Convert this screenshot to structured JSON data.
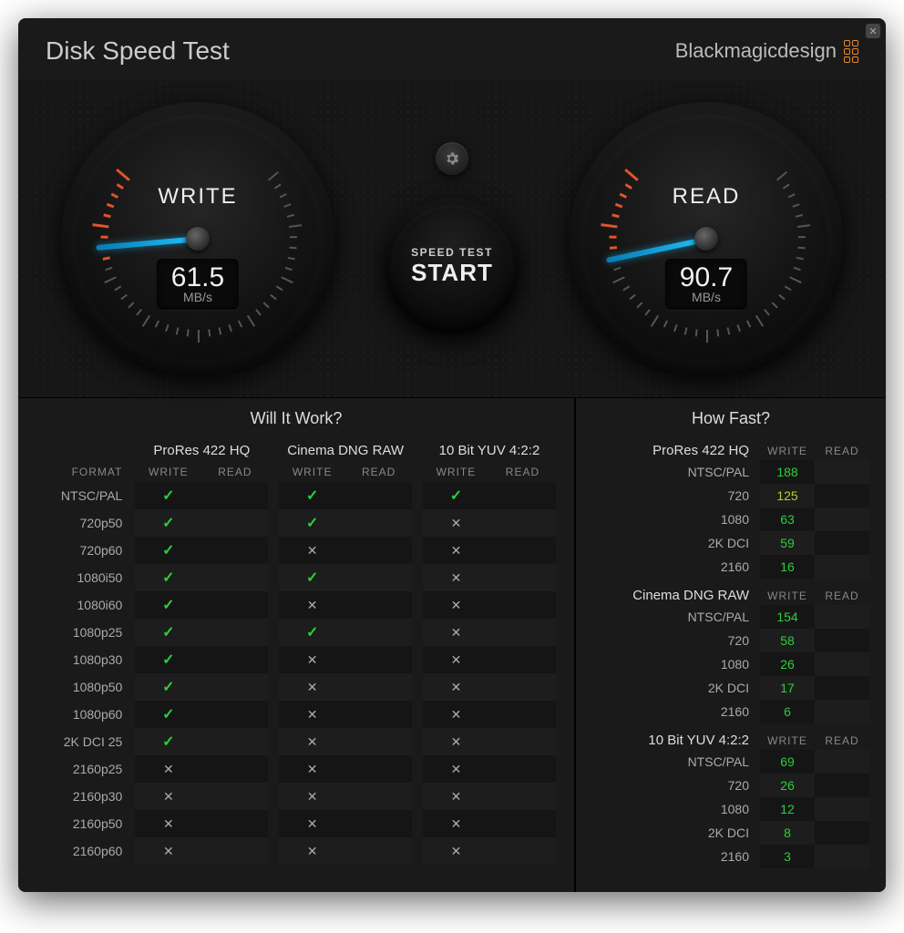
{
  "app": {
    "title": "Disk Speed Test",
    "brand": "Blackmagicdesign"
  },
  "gauges": {
    "write": {
      "label": "WRITE",
      "value": "61.5",
      "unit": "MB/s",
      "needle_angle": 85
    },
    "read": {
      "label": "READ",
      "value": "90.7",
      "unit": "MB/s",
      "needle_angle": 78
    }
  },
  "center": {
    "start_sub": "SPEED TEST",
    "start_main": "START"
  },
  "will_it_work": {
    "title": "Will It Work?",
    "format_header": "FORMAT",
    "groups": [
      "ProRes 422 HQ",
      "Cinema DNG RAW",
      "10 Bit YUV 4:2:2"
    ],
    "subcols": [
      "WRITE",
      "READ"
    ],
    "rows": [
      {
        "format": "NTSC/PAL",
        "cells": [
          "check",
          "",
          "check",
          "",
          "check",
          ""
        ]
      },
      {
        "format": "720p50",
        "cells": [
          "check",
          "",
          "check",
          "",
          "cross",
          ""
        ]
      },
      {
        "format": "720p60",
        "cells": [
          "check",
          "",
          "cross",
          "",
          "cross",
          ""
        ]
      },
      {
        "format": "1080i50",
        "cells": [
          "check",
          "",
          "check",
          "",
          "cross",
          ""
        ]
      },
      {
        "format": "1080i60",
        "cells": [
          "check",
          "",
          "cross",
          "",
          "cross",
          ""
        ]
      },
      {
        "format": "1080p25",
        "cells": [
          "check",
          "",
          "check",
          "",
          "cross",
          ""
        ]
      },
      {
        "format": "1080p30",
        "cells": [
          "check",
          "",
          "cross",
          "",
          "cross",
          ""
        ]
      },
      {
        "format": "1080p50",
        "cells": [
          "check",
          "",
          "cross",
          "",
          "cross",
          ""
        ]
      },
      {
        "format": "1080p60",
        "cells": [
          "check",
          "",
          "cross",
          "",
          "cross",
          ""
        ]
      },
      {
        "format": "2K DCI 25",
        "cells": [
          "check",
          "",
          "cross",
          "",
          "cross",
          ""
        ]
      },
      {
        "format": "2160p25",
        "cells": [
          "cross",
          "",
          "cross",
          "",
          "cross",
          ""
        ]
      },
      {
        "format": "2160p30",
        "cells": [
          "cross",
          "",
          "cross",
          "",
          "cross",
          ""
        ]
      },
      {
        "format": "2160p50",
        "cells": [
          "cross",
          "",
          "cross",
          "",
          "cross",
          ""
        ]
      },
      {
        "format": "2160p60",
        "cells": [
          "cross",
          "",
          "cross",
          "",
          "cross",
          ""
        ]
      }
    ]
  },
  "how_fast": {
    "title": "How Fast?",
    "subcols": [
      "WRITE",
      "READ"
    ],
    "groups": [
      {
        "name": "ProRes 422 HQ",
        "rows": [
          {
            "label": "NTSC/PAL",
            "write": "188",
            "read": ""
          },
          {
            "label": "720",
            "write": "125",
            "read": "",
            "write_style": "yellowish"
          },
          {
            "label": "1080",
            "write": "63",
            "read": ""
          },
          {
            "label": "2K DCI",
            "write": "59",
            "read": ""
          },
          {
            "label": "2160",
            "write": "16",
            "read": ""
          }
        ]
      },
      {
        "name": "Cinema DNG RAW",
        "rows": [
          {
            "label": "NTSC/PAL",
            "write": "154",
            "read": ""
          },
          {
            "label": "720",
            "write": "58",
            "read": ""
          },
          {
            "label": "1080",
            "write": "26",
            "read": ""
          },
          {
            "label": "2K DCI",
            "write": "17",
            "read": ""
          },
          {
            "label": "2160",
            "write": "6",
            "read": ""
          }
        ]
      },
      {
        "name": "10 Bit YUV 4:2:2",
        "rows": [
          {
            "label": "NTSC/PAL",
            "write": "69",
            "read": ""
          },
          {
            "label": "720",
            "write": "26",
            "read": ""
          },
          {
            "label": "1080",
            "write": "12",
            "read": ""
          },
          {
            "label": "2K DCI",
            "write": "8",
            "read": ""
          },
          {
            "label": "2160",
            "write": "3",
            "read": ""
          }
        ]
      }
    ]
  }
}
